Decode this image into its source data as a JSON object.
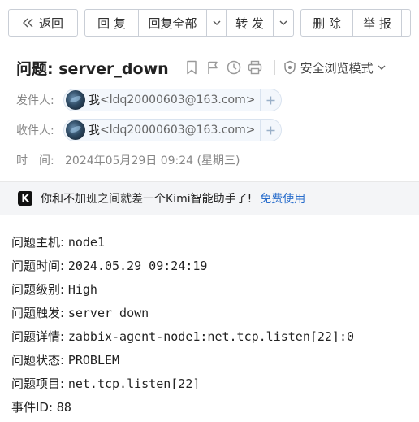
{
  "toolbar": {
    "back_label": "返回",
    "reply_label": "回 复",
    "reply_all_label": "回复全部",
    "forward_label": "转 发",
    "delete_label": "删 除",
    "report_label": "举 报"
  },
  "mail": {
    "subject": "问题: server_down",
    "safe_mode_label": "安全浏览模式",
    "sender_label": "发件人:",
    "recipient_label": "收件人:",
    "sender": {
      "name": "我",
      "email": "<ldq20000603@163.com>"
    },
    "recipient": {
      "name": "我",
      "email": "<ldq20000603@163.com>"
    },
    "time_label": "时　间:",
    "time_value": "2024年05月29日 09:24 (星期三)"
  },
  "promo": {
    "logo_letter": "K",
    "text": "你和不加班之间就差一个Kimi智能助手了!",
    "link": "免费使用"
  },
  "body": {
    "lines": [
      {
        "key": "问题主机: ",
        "value": "node1"
      },
      {
        "key": "问题时间: ",
        "value": "2024.05.29 09:24:19"
      },
      {
        "key": "问题级别: ",
        "value": "High"
      },
      {
        "key": "问题触发: ",
        "value": "server_down"
      },
      {
        "key": "问题详情: ",
        "value": "zabbix-agent-node1:net.tcp.listen[22]:0"
      },
      {
        "key": "问题状态: ",
        "value": "PROBLEM"
      },
      {
        "key": "问题项目: ",
        "value": "net.tcp.listen[22]"
      },
      {
        "key": "事件ID: ",
        "value": "88"
      }
    ]
  }
}
